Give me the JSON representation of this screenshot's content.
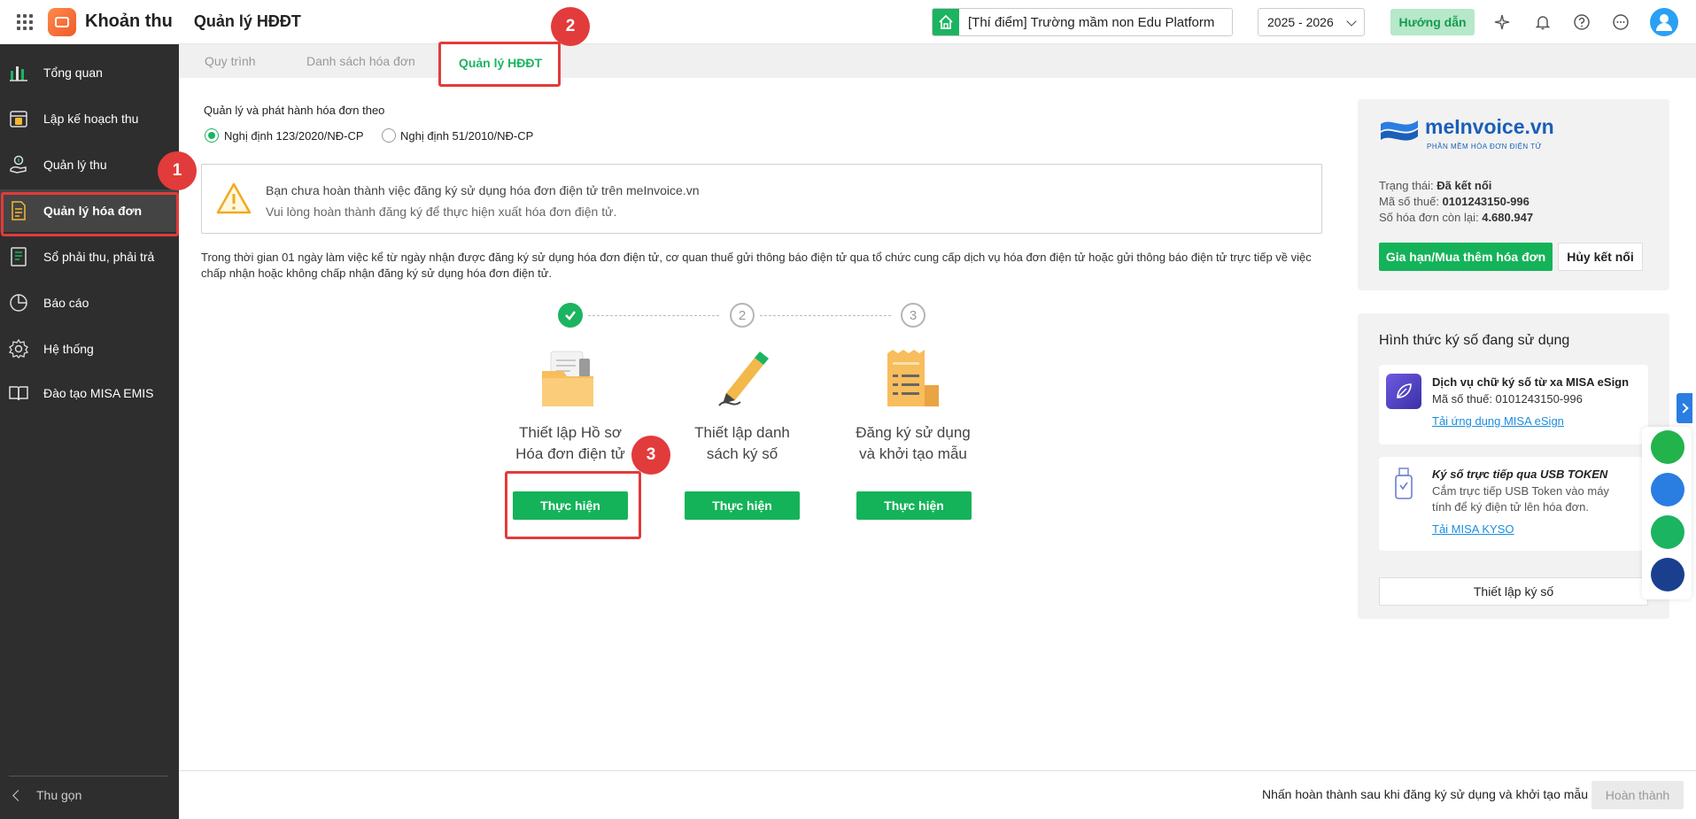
{
  "header": {
    "app_name": "Khoản thu",
    "page_title": "Quản lý HĐĐT",
    "school": "[Thí điểm] Trường mầm non Edu Platform",
    "year": "2025 - 2026",
    "guide_label": "Hướng dẫn"
  },
  "sidebar": {
    "items": [
      {
        "label": "Tổng quan",
        "icon": "bar-chart-icon"
      },
      {
        "label": "Lập kế hoạch thu",
        "icon": "calendar-money-icon"
      },
      {
        "label": "Quản lý thu",
        "icon": "hand-coin-icon"
      },
      {
        "label": "Quản lý hóa đơn",
        "icon": "invoice-icon"
      },
      {
        "label": "Sổ phải thu, phải trả",
        "icon": "ledger-icon"
      },
      {
        "label": "Báo cáo",
        "icon": "pie-chart-icon"
      },
      {
        "label": "Hệ thống",
        "icon": "gear-icon"
      },
      {
        "label": "Đào tạo MISA EMIS",
        "icon": "book-icon"
      }
    ],
    "collapse_label": "Thu gọn"
  },
  "tabs": [
    "Quy trình",
    "Danh sách hóa đơn",
    "Quản lý HĐĐT"
  ],
  "main": {
    "manage_label": "Quản lý và phát hành hóa đơn theo",
    "radio_1": "Nghị định 123/2020/NĐ-CP",
    "radio_2": "Nghị định 51/2010/NĐ-CP",
    "warning_line1": "Bạn chưa hoàn thành việc đăng ký sử dụng hóa đơn điện tử trên meInvoice.vn",
    "warning_line2": "Vui lòng hoàn thành đăng ký để thực hiện xuất hóa đơn điện tử.",
    "notice": "Trong thời gian 01 ngày làm việc kể từ ngày nhận được đăng ký sử dụng hóa đơn điện tử, cơ quan thuế gửi thông báo điện tử qua tổ chức cung cấp dịch vụ hóa đơn điện tử hoặc gửi thông báo điện tử trực tiếp về việc chấp nhận hoặc không chấp nhận đăng ký sử dụng hóa đơn điện tử.",
    "steps": [
      {
        "number": "1",
        "title_line1": "Thiết lập Hồ sơ",
        "title_line2": "Hóa đơn điện tử",
        "button": "Thực hiện"
      },
      {
        "number": "2",
        "title_line1": "Thiết lập danh",
        "title_line2": "sách ký số",
        "button": "Thực hiện"
      },
      {
        "number": "3",
        "title_line1": "Đăng ký sử dụng",
        "title_line2": "và khởi tạo mẫu",
        "button": "Thực hiện"
      }
    ]
  },
  "meinvoice": {
    "logo_text": "meInvoice.vn",
    "logo_sub": "PHẦN MỀM HÓA ĐƠN ĐIỆN TỬ",
    "status_label": "Trạng thái: ",
    "status_value": "Đã kết nối",
    "tax_label": "Mã số thuế: ",
    "tax_value": "0101243150-996",
    "remaining_label": "Số hóa đơn còn lại: ",
    "remaining_value": "4.680.947",
    "renew_button": "Gia hạn/Mua thêm hóa đơn",
    "unlink_button": "Hủy kết nối"
  },
  "signing": {
    "title": "Hình thức ký số đang sử dụng",
    "esign_title": "Dịch vụ chữ ký số từ xa MISA eSign",
    "esign_tax": "Mã số thuế: 0101243150-996",
    "esign_link": "Tải ứng dụng MISA eSign",
    "usb_title": "Ký số trực tiếp qua USB TOKEN",
    "usb_desc_1": "Cắm trực tiếp USB Token vào máy",
    "usb_desc_2": "tính để ký điện tử lên hóa đơn.",
    "usb_link": "Tải MISA KYSO",
    "setup_button": "Thiết lập ký số"
  },
  "annotations": [
    "1",
    "2",
    "3"
  ],
  "footer": {
    "hint": "Nhấn hoàn thành sau khi đăng ký sử dụng và khởi tạo mẫu",
    "done_button": "Hoàn thành"
  },
  "colors": {
    "accent": "#1bb461",
    "sidebar": "#2e2e2e",
    "annotation": "#e23b3b",
    "link": "#1a8de0"
  }
}
